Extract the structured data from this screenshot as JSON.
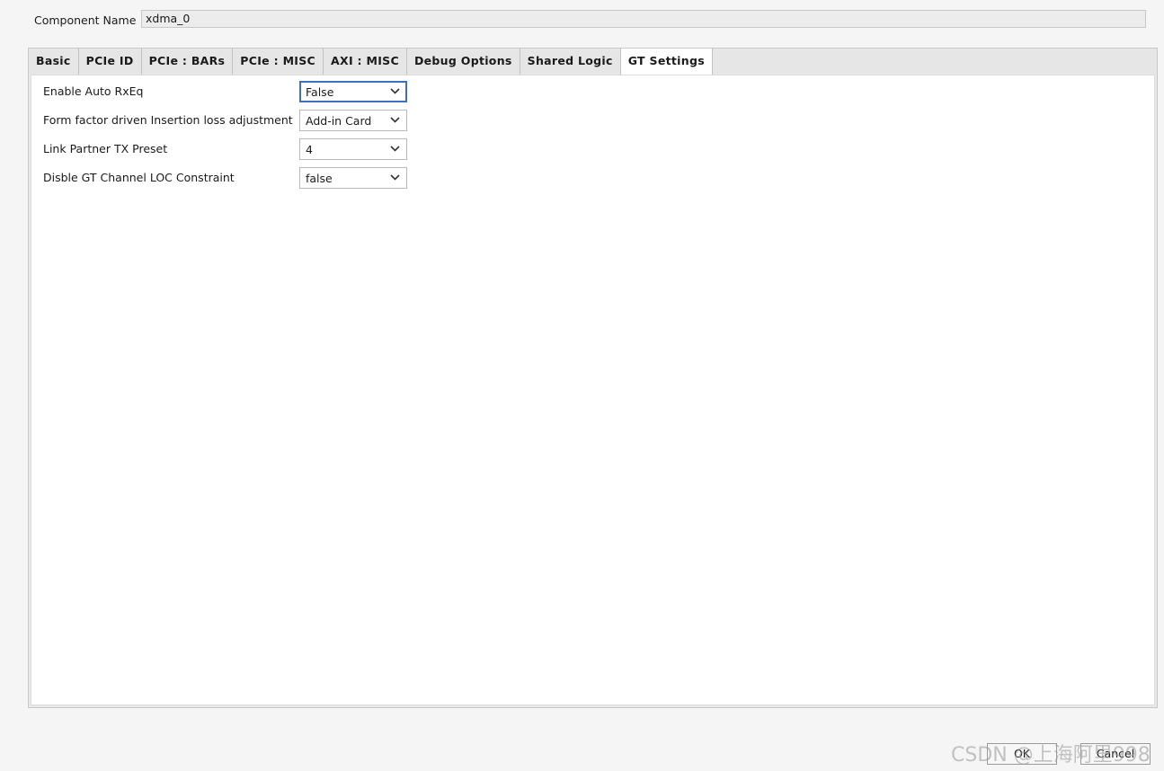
{
  "component": {
    "label": "Component Name",
    "value": "xdma_0"
  },
  "tabs": [
    {
      "label": "Basic"
    },
    {
      "label": "PCIe ID"
    },
    {
      "label": "PCIe : BARs"
    },
    {
      "label": "PCIe : MISC"
    },
    {
      "label": "AXI : MISC"
    },
    {
      "label": "Debug Options"
    },
    {
      "label": "Shared Logic"
    },
    {
      "label": "GT Settings",
      "active": true
    }
  ],
  "settings": [
    {
      "label": "Enable Auto RxEq",
      "value": "False"
    },
    {
      "label": "Form factor driven Insertion loss adjustment",
      "value": "Add-in Card"
    },
    {
      "label": "Link Partner TX Preset",
      "value": "4"
    },
    {
      "label": "Disble GT Channel LOC Constraint",
      "value": "false"
    }
  ],
  "buttons": {
    "ok": "OK",
    "cancel": "Cancel"
  },
  "watermark": "CSDN @上海阿里998",
  "colors": {
    "focus": "#3d6fc2",
    "background": "#f5f5f5"
  },
  "icons": {
    "dropdown": "chevron-down-icon"
  }
}
